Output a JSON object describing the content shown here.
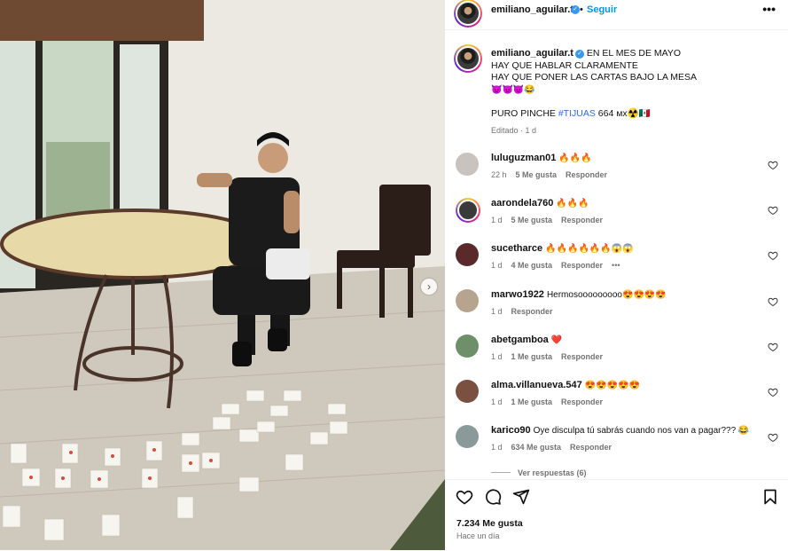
{
  "post": {
    "username": "emiliano_aguilar.t",
    "follow_label": "Seguir",
    "separator": "•",
    "more_label": "•••",
    "caption_lines": [
      "EN EL MES DE MAYO",
      "HAY QUE HABLAR CLARAMENTE",
      "HAY QUE PONER LAS CARTAS BAJO LA MESA"
    ],
    "caption_emojis": "😈😈😈😂",
    "caption_tail_prefix": "PURO PINCHE ",
    "caption_hashtag": "#TIJUAS",
    "caption_tail_suffix": " 664 ᴍx☢️🇲🇽",
    "edited_label": "Editado · 1 d",
    "likes": "7.234 Me gusta",
    "time_ago": "Hace un día",
    "view_replies": "Ver respuestas (6)"
  },
  "comments": [
    {
      "user": "luluguzman01",
      "text": "🔥🔥🔥",
      "time": "22 h",
      "likes": "5 Me gusta",
      "reply": "Responder",
      "avatar_color": "#c9c3c0",
      "ring": false
    },
    {
      "user": "aarondela760",
      "text": "🔥🔥🔥",
      "time": "1 d",
      "likes": "5 Me gusta",
      "reply": "Responder",
      "avatar_color": "#3a3a3a",
      "ring": true
    },
    {
      "user": "sucetharce",
      "text": "🔥🔥🔥🔥🔥🔥😱😱",
      "time": "1 d",
      "likes": "4 Me gusta",
      "reply": "Responder",
      "extra": "•••",
      "avatar_color": "#5a2a2a",
      "ring": false
    },
    {
      "user": "marwo1922",
      "text": "Hermosooooooooo😍😍😍😍",
      "time": "1 d",
      "likes": "",
      "reply": "Responder",
      "avatar_color": "#b7a48f",
      "ring": false
    },
    {
      "user": "abetgamboa",
      "text": "❤️",
      "time": "1 d",
      "likes": "1 Me gusta",
      "reply": "Responder",
      "avatar_color": "#6f8f6a",
      "ring": false
    },
    {
      "user": "alma.villanueva.547",
      "text": "😍😍😍😍😍",
      "time": "1 d",
      "likes": "1 Me gusta",
      "reply": "Responder",
      "avatar_color": "#7a5040",
      "ring": false
    },
    {
      "user": "karico90",
      "text": "Oye disculpa tú sabrás cuando nos van a pagar??? 😂",
      "time": "1 d",
      "likes": "634 Me gusta",
      "reply": "Responder",
      "avatar_color": "#8a9a9a",
      "ring": false
    }
  ]
}
